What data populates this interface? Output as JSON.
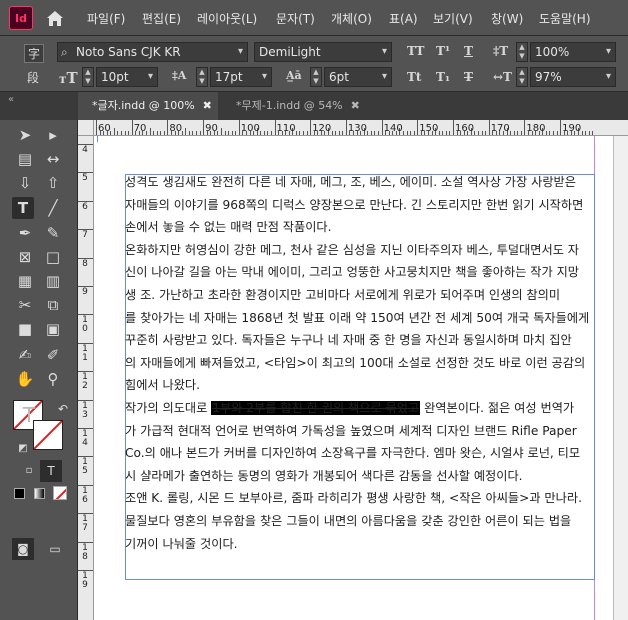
{
  "app": {
    "logo": "Id"
  },
  "menu": [
    "파일(F)",
    "편집(E)",
    "레이아웃(L)",
    "문자(T)",
    "개체(O)",
    "표(A)",
    "보기(V)",
    "창(W)",
    "도움말(H)"
  ],
  "control": {
    "char_mode": "字",
    "para_mode": "段",
    "font_family": "Noto Sans CJK KR",
    "font_style": "DemiLight",
    "font_size": "10pt",
    "leading": "17pt",
    "tracking": "6pt",
    "vscale": "100%",
    "hscale": "97%",
    "tt_caps": "TT",
    "tt_super": "T¹",
    "tt_small": "Tt",
    "tt_sub": "T₁",
    "tt_under": "T",
    "tt_strike": "T"
  },
  "tabs": [
    {
      "label": "*글자.indd @ 100%",
      "close": "✖",
      "active": true
    },
    {
      "label": "*무제-1.indd @ 54%",
      "close": "✖",
      "active": false
    }
  ],
  "ruler": {
    "top": [
      "60",
      "70",
      "80",
      "90",
      "100",
      "110",
      "120",
      "130",
      "140",
      "150",
      "160",
      "170",
      "180",
      "190"
    ],
    "left": [
      "4",
      "5",
      "6",
      "7",
      "8",
      "9",
      "10",
      "11",
      "12",
      "13",
      "14",
      "15",
      "16",
      "17",
      "18",
      "19"
    ]
  },
  "document": {
    "lines": [
      "성격도 생김새도 완전히 다른 네 자매, 메그, 조, 베스, 에이미. 소설 역사상 가장 사랑받은",
      "자매들의 이야기를 968쪽의 디럭스 양장본으로 만난다. 긴 스토리지만 한번 읽기 시작하면",
      "손에서 놓을 수 없는 매력 만점 작품이다.",
      "온화하지만 허영심이 강한 메그, 천사 같은 심성을 지닌 이타주의자 베스, 투덜대면서도 자",
      "신이 나아갈 길을 아는 막내 에이미, 그리고 엉뚱한 사고뭉치지만 책을 좋아하는 작가 지망",
      "생 조. 가난하고 초라한 환경이지만 고비마다 서로에게 위로가 되어주며 인생의 참의미",
      "를 찾아가는 네 자매는 1868년 첫 발표 이래 약 150여 년간 전 세계 50여 개국 독자들에게",
      "꾸준히 사랑받고 있다. 독자들은 누구나 네 자매 중 한 명을 자신과 동일시하며 마치 집안",
      "의 자매들에게 빠져들었고, <타임>이 최고의 100대 소설로 선정한 것도 바로 이런 공감의",
      "힘에서 나왔다."
    ],
    "line11_pre": "작가의 의도대로 ",
    "line11_hl": "1부와 2부를 합친 한 권의 책으로 묶었고",
    "line11_post": " 완역본이다. 젊은 여성 번역가",
    "lines2": [
      "가 가급적 현대적 언어로 번역하여 가독성을 높였으며 세계적 디자인 브랜드 Rifle Paper",
      "Co.의 애나 본드가 커버를 디자인하여 소장욕구를 자극한다. 엠마 왓슨, 시얼샤 로넌, 티모",
      "시 샬라메가 출연하는 동명의 영화가 개봉되어 색다른 감동을 선사할 예정이다.",
      "조앤 K. 롤링, 시몬 드 보부아르, 줌파 라히리가 평생 사랑한 책, <작은 아씨들>과 만나라.",
      "물질보다 영혼의 부유함을 찾은 그들이 내면의 아름다움을 갖춘 강인한 어른이 되는 법을",
      "기꺼이 나눠줄 것이다."
    ]
  },
  "colors": {
    "accent": "#ff3366",
    "frame": "#6a8bd9",
    "margin": "#c985d8"
  }
}
